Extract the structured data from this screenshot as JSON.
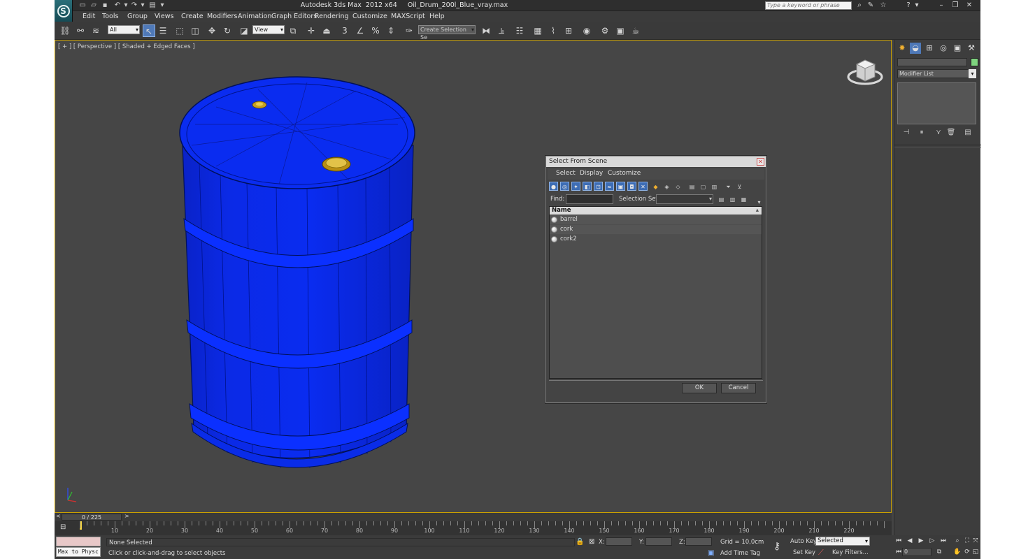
{
  "window": {
    "title": "Autodesk 3ds Max  2012 x64     Oil_Drum_200l_Blue_vray.max",
    "search_placeholder": "Type a keyword or phrase"
  },
  "menus": [
    "Edit",
    "Tools",
    "Group",
    "Views",
    "Create",
    "Modifiers",
    "Animation",
    "Graph Editors",
    "Rendering",
    "Customize",
    "MAXScript",
    "Help"
  ],
  "toolbar": {
    "selection_filter": "All",
    "reference_coord": "View",
    "named_selection_placeholder": "Create Selection Se",
    "snap_label": "3"
  },
  "viewport": {
    "label": "[ + ] [ Perspective ] [ Shaded + Edged Faces ]",
    "object_color": "#0a2cf0"
  },
  "command_panel": {
    "modifier_list": "Modifier List",
    "object_color": "#7fd47f"
  },
  "dialog": {
    "title": "Select From Scene",
    "menus": [
      "Select",
      "Display",
      "Customize"
    ],
    "find_label": "Find:",
    "find_value": "",
    "selection_set_label": "Selection Set:",
    "column_name": "Name",
    "objects": [
      "barrel",
      "cork",
      "cork2"
    ],
    "ok": "OK",
    "cancel": "Cancel"
  },
  "timeline": {
    "frame_display": "0 / 225",
    "ticks": [
      10,
      20,
      30,
      40,
      50,
      60,
      70,
      80,
      90,
      100,
      110,
      120,
      130,
      140,
      150,
      160,
      170,
      180,
      190,
      200,
      210,
      220
    ]
  },
  "status": {
    "maxscript": "Max to Physc",
    "selection": "None Selected",
    "prompt": "Click or click-and-drag to select objects",
    "x_label": "X:",
    "y_label": "Y:",
    "z_label": "Z:",
    "grid": "Grid = 10,0cm",
    "add_time_tag": "Add Time Tag",
    "auto_key": "Auto Key",
    "set_key": "Set Key",
    "key_mode": "Selected",
    "key_filters": "Key Filters...",
    "current_frame": "0"
  }
}
